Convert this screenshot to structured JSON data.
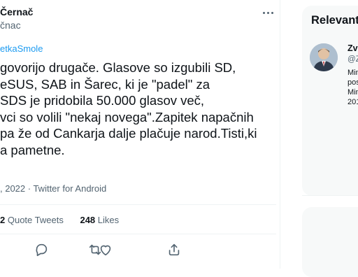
{
  "author": {
    "name": "Černač",
    "handle": "čnac"
  },
  "replying_to": "etkaSmole",
  "tweet_lines": [
    "govorijo drugače. Glasove so izgubili SD,",
    "eSUS, SAB in Šarec, ki je \"padel\" za",
    "SDS je pridobila 50.000 glasov več,",
    "vci so volili \"nekaj novega\".Zapitek napačnih",
    "pa že od Cankarja dalje plačuje narod.Tisti,ki",
    "a pametne."
  ],
  "meta": ", 2022 · Twitter for Android",
  "stats": {
    "quote_count": "2",
    "quote_label": "Quote Tweets",
    "likes_count": "248",
    "likes_label": "Likes"
  },
  "sidebar": {
    "title": "Relevant",
    "user": {
      "name": "Zve",
      "handle": "@Z",
      "bio_lines": [
        "Min",
        "pos",
        "Min",
        "201"
      ]
    }
  },
  "colors": {
    "accent": "#1d9bf0",
    "muted": "#536471",
    "text": "#0f1419",
    "border": "#eff3f4",
    "card": "#f7f9f9"
  },
  "icons": {
    "more": "more-dots-icon",
    "reply": "reply-icon",
    "retweet": "retweet-icon",
    "like": "heart-icon",
    "share": "share-icon"
  }
}
